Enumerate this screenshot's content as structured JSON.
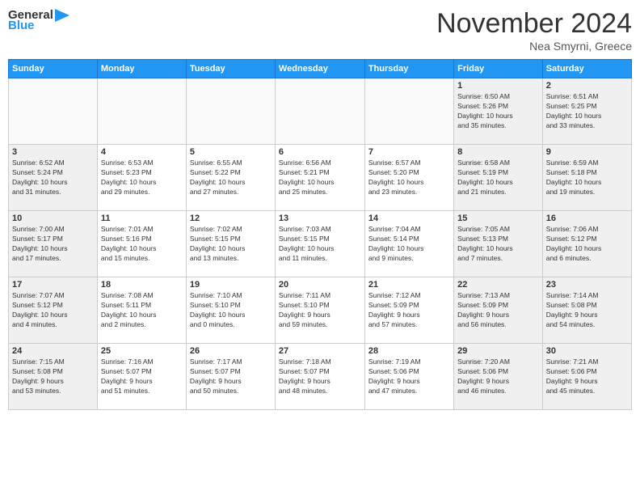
{
  "header": {
    "logo": {
      "general": "General",
      "blue": "Blue"
    },
    "title": "November 2024",
    "location": "Nea Smyrni, Greece"
  },
  "calendar": {
    "days_of_week": [
      "Sunday",
      "Monday",
      "Tuesday",
      "Wednesday",
      "Thursday",
      "Friday",
      "Saturday"
    ],
    "weeks": [
      [
        {
          "day": "",
          "type": "empty",
          "info": ""
        },
        {
          "day": "",
          "type": "empty",
          "info": ""
        },
        {
          "day": "",
          "type": "empty",
          "info": ""
        },
        {
          "day": "",
          "type": "empty",
          "info": ""
        },
        {
          "day": "",
          "type": "empty",
          "info": ""
        },
        {
          "day": "1",
          "type": "weekend",
          "info": "Sunrise: 6:50 AM\nSunset: 5:26 PM\nDaylight: 10 hours\nand 35 minutes."
        },
        {
          "day": "2",
          "type": "weekend",
          "info": "Sunrise: 6:51 AM\nSunset: 5:25 PM\nDaylight: 10 hours\nand 33 minutes."
        }
      ],
      [
        {
          "day": "3",
          "type": "weekend",
          "info": "Sunrise: 6:52 AM\nSunset: 5:24 PM\nDaylight: 10 hours\nand 31 minutes."
        },
        {
          "day": "4",
          "type": "weekday",
          "info": "Sunrise: 6:53 AM\nSunset: 5:23 PM\nDaylight: 10 hours\nand 29 minutes."
        },
        {
          "day": "5",
          "type": "weekday",
          "info": "Sunrise: 6:55 AM\nSunset: 5:22 PM\nDaylight: 10 hours\nand 27 minutes."
        },
        {
          "day": "6",
          "type": "weekday",
          "info": "Sunrise: 6:56 AM\nSunset: 5:21 PM\nDaylight: 10 hours\nand 25 minutes."
        },
        {
          "day": "7",
          "type": "weekday",
          "info": "Sunrise: 6:57 AM\nSunset: 5:20 PM\nDaylight: 10 hours\nand 23 minutes."
        },
        {
          "day": "8",
          "type": "weekend",
          "info": "Sunrise: 6:58 AM\nSunset: 5:19 PM\nDaylight: 10 hours\nand 21 minutes."
        },
        {
          "day": "9",
          "type": "weekend",
          "info": "Sunrise: 6:59 AM\nSunset: 5:18 PM\nDaylight: 10 hours\nand 19 minutes."
        }
      ],
      [
        {
          "day": "10",
          "type": "weekend",
          "info": "Sunrise: 7:00 AM\nSunset: 5:17 PM\nDaylight: 10 hours\nand 17 minutes."
        },
        {
          "day": "11",
          "type": "weekday",
          "info": "Sunrise: 7:01 AM\nSunset: 5:16 PM\nDaylight: 10 hours\nand 15 minutes."
        },
        {
          "day": "12",
          "type": "weekday",
          "info": "Sunrise: 7:02 AM\nSunset: 5:15 PM\nDaylight: 10 hours\nand 13 minutes."
        },
        {
          "day": "13",
          "type": "weekday",
          "info": "Sunrise: 7:03 AM\nSunset: 5:15 PM\nDaylight: 10 hours\nand 11 minutes."
        },
        {
          "day": "14",
          "type": "weekday",
          "info": "Sunrise: 7:04 AM\nSunset: 5:14 PM\nDaylight: 10 hours\nand 9 minutes."
        },
        {
          "day": "15",
          "type": "weekend",
          "info": "Sunrise: 7:05 AM\nSunset: 5:13 PM\nDaylight: 10 hours\nand 7 minutes."
        },
        {
          "day": "16",
          "type": "weekend",
          "info": "Sunrise: 7:06 AM\nSunset: 5:12 PM\nDaylight: 10 hours\nand 6 minutes."
        }
      ],
      [
        {
          "day": "17",
          "type": "weekend",
          "info": "Sunrise: 7:07 AM\nSunset: 5:12 PM\nDaylight: 10 hours\nand 4 minutes."
        },
        {
          "day": "18",
          "type": "weekday",
          "info": "Sunrise: 7:08 AM\nSunset: 5:11 PM\nDaylight: 10 hours\nand 2 minutes."
        },
        {
          "day": "19",
          "type": "weekday",
          "info": "Sunrise: 7:10 AM\nSunset: 5:10 PM\nDaylight: 10 hours\nand 0 minutes."
        },
        {
          "day": "20",
          "type": "weekday",
          "info": "Sunrise: 7:11 AM\nSunset: 5:10 PM\nDaylight: 9 hours\nand 59 minutes."
        },
        {
          "day": "21",
          "type": "weekday",
          "info": "Sunrise: 7:12 AM\nSunset: 5:09 PM\nDaylight: 9 hours\nand 57 minutes."
        },
        {
          "day": "22",
          "type": "weekend",
          "info": "Sunrise: 7:13 AM\nSunset: 5:09 PM\nDaylight: 9 hours\nand 56 minutes."
        },
        {
          "day": "23",
          "type": "weekend",
          "info": "Sunrise: 7:14 AM\nSunset: 5:08 PM\nDaylight: 9 hours\nand 54 minutes."
        }
      ],
      [
        {
          "day": "24",
          "type": "weekend",
          "info": "Sunrise: 7:15 AM\nSunset: 5:08 PM\nDaylight: 9 hours\nand 53 minutes."
        },
        {
          "day": "25",
          "type": "weekday",
          "info": "Sunrise: 7:16 AM\nSunset: 5:07 PM\nDaylight: 9 hours\nand 51 minutes."
        },
        {
          "day": "26",
          "type": "weekday",
          "info": "Sunrise: 7:17 AM\nSunset: 5:07 PM\nDaylight: 9 hours\nand 50 minutes."
        },
        {
          "day": "27",
          "type": "weekday",
          "info": "Sunrise: 7:18 AM\nSunset: 5:07 PM\nDaylight: 9 hours\nand 48 minutes."
        },
        {
          "day": "28",
          "type": "weekday",
          "info": "Sunrise: 7:19 AM\nSunset: 5:06 PM\nDaylight: 9 hours\nand 47 minutes."
        },
        {
          "day": "29",
          "type": "weekend",
          "info": "Sunrise: 7:20 AM\nSunset: 5:06 PM\nDaylight: 9 hours\nand 46 minutes."
        },
        {
          "day": "30",
          "type": "weekend",
          "info": "Sunrise: 7:21 AM\nSunset: 5:06 PM\nDaylight: 9 hours\nand 45 minutes."
        }
      ]
    ]
  }
}
